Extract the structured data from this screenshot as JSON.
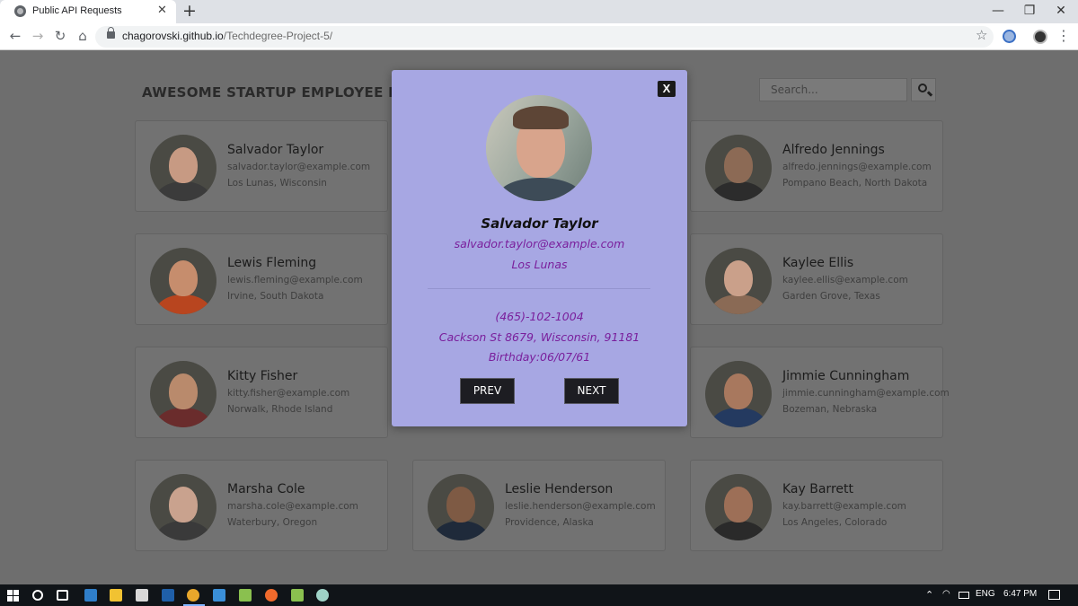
{
  "browser": {
    "tab_title": "Public API Requests",
    "tab_close": "✕",
    "new_tab": "+",
    "url_host": "chagorovski.github.io",
    "url_path": "/Techdegree-Project-5/",
    "window_controls": [
      "—",
      "❐",
      "✕"
    ],
    "nav_icons": {
      "back": "←",
      "forward": "→",
      "reload": "↻",
      "home": "⌂",
      "star": "☆",
      "menu": "⋮"
    }
  },
  "page": {
    "title": "AWESOME STARTUP EMPLOYEE DIRECTORY",
    "search_placeholder": "Search..."
  },
  "employees": [
    {
      "name": "Salvador Taylor",
      "email": "salvador.taylor@example.com",
      "location": "Los Lunas, Wisconsin",
      "skin": "#c79a83",
      "top": "#3b3b3b"
    },
    {
      "name": "Alfredo Jennings",
      "email": "alfredo.jennings@example.com",
      "location": "Pompano Beach, North Dakota",
      "skin": "#8c6a55",
      "top": "#2c2c2c"
    },
    {
      "name": "Lewis Fleming",
      "email": "lewis.fleming@example.com",
      "location": "Irvine, South Dakota",
      "skin": "#c68d6d",
      "top": "#b8451f"
    },
    {
      "name": "Kaylee Ellis",
      "email": "kaylee.ellis@example.com",
      "location": "Garden Grove, Texas",
      "skin": "#caa08a",
      "top": "#8a6a55"
    },
    {
      "name": "Kitty Fisher",
      "email": "kitty.fisher@example.com",
      "location": "Norwalk, Rhode Island",
      "skin": "#b98a6c",
      "top": "#6a2c2c"
    },
    {
      "name": "Jimmie Cunningham",
      "email": "jimmie.cunningham@example.com",
      "location": "Bozeman, Nebraska",
      "skin": "#a8785e",
      "top": "#243a60"
    },
    {
      "name": "Marsha Cole",
      "email": "marsha.cole@example.com",
      "location": "Waterbury, Oregon",
      "skin": "#c9a28e",
      "top": "#3a3a3a"
    },
    {
      "name": "Leslie Henderson",
      "email": "leslie.henderson@example.com",
      "location": "Providence, Alaska",
      "skin": "#7e5a44",
      "top": "#1f2a3a"
    },
    {
      "name": "Kay Barrett",
      "email": "kay.barrett@example.com",
      "location": "Los Angeles, Colorado",
      "skin": "#9d6f57",
      "top": "#2a2a2a"
    }
  ],
  "modal": {
    "close_label": "X",
    "name": "Salvador Taylor",
    "email": "salvador.taylor@example.com",
    "city": "Los Lunas",
    "phone": "(465)-102-1004",
    "address": "Cackson St 8679, Wisconsin, 91181",
    "birthday": "Birthday:06/07/61",
    "prev_label": "PREV",
    "next_label": "NEXT"
  },
  "taskbar": {
    "language": "ENG",
    "time": "6:47 PM",
    "apps": [
      {
        "name": "lightroom-icon",
        "color": "#2f7ec9"
      },
      {
        "name": "file-explorer-icon",
        "color": "#f1c232"
      },
      {
        "name": "photos-icon",
        "color": "#d8d8d8"
      },
      {
        "name": "photoshop-icon",
        "color": "#1f5fa8"
      },
      {
        "name": "chrome-icon",
        "color": "#e8a72b"
      },
      {
        "name": "vscode-icon",
        "color": "#3a8fd8"
      },
      {
        "name": "git-icon",
        "color": "#8ac04f"
      },
      {
        "name": "postman-icon",
        "color": "#f06a2c"
      },
      {
        "name": "sourcetree-icon",
        "color": "#8ac04f"
      },
      {
        "name": "app-icon",
        "color": "#9fd3c7"
      }
    ]
  },
  "colors": {
    "overlay_bg": "#6e6e6e",
    "modal_bg": "#a7a7e3",
    "modal_text": "#7a1f9c",
    "button_bg": "#1d1d22"
  }
}
